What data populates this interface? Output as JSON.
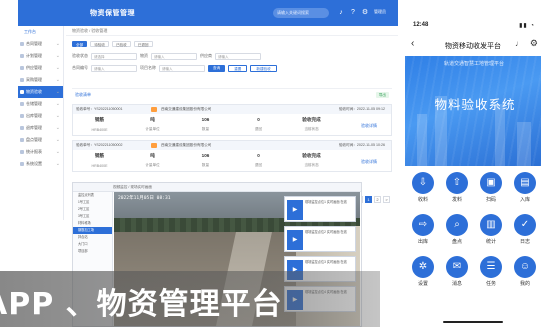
{
  "desktop": {
    "title": "物资保管管理",
    "search_placeholder": "请输入关键词搜索",
    "user": "管理员",
    "brand": "工作台",
    "nav": [
      "合同管理",
      "计划管理",
      "供应管理",
      "采购管理",
      "物资验收",
      "仓储管理",
      "出库管理",
      "退库管理",
      "盘点管理",
      "统计报表",
      "系统设置"
    ],
    "active_nav": 4,
    "breadcrumb": "物资验收 / 验收管理",
    "tabs": [
      "全部",
      "待验收",
      "已验收",
      "已退回"
    ],
    "filter_labels": {
      "row2_a": "验收状态",
      "row2_b": "物资",
      "row2_c": "供应商",
      "row3_a": "合同编号",
      "row3_b": "项目名称"
    },
    "placeholders": {
      "a": "请选择",
      "b": "请输入",
      "c": "请输入"
    },
    "buttons": {
      "search": "查询",
      "reset": "重置",
      "add": "新建验收"
    },
    "list_title": "验收清单",
    "export": "导出",
    "cards": [
      {
        "no": "验收单号：YS202211050001",
        "org": "西南交通建设集团股份有限公司",
        "time": "验收时间：2022-11-05 09:12",
        "cols": [
          "钢筋",
          "吨",
          "106",
          "0",
          "验收完成"
        ],
        "subs": [
          "HRB400E",
          "计量单位",
          "数量",
          "退回",
          "当前状态"
        ],
        "link": "验收详情"
      },
      {
        "no": "验收单号：YS202211050002",
        "org": "西南交通建设集团股份有限公司",
        "time": "验收时间：2022-11-05 10:26",
        "cols": [
          "钢筋",
          "吨",
          "106",
          "0",
          "验收完成"
        ],
        "subs": [
          "HRB400E",
          "计量单位",
          "数量",
          "退回",
          "当前状态"
        ],
        "link": "验收详情"
      }
    ],
    "pager": [
      "<",
      "1",
      "2",
      ">"
    ]
  },
  "mobile": {
    "time": "12:48",
    "battery": "▮▮ ◔",
    "back": "‹",
    "title": "物资移动收发平台",
    "banner_sub": "轨道交通智慧工地管理平台",
    "banner_big": "物料验收系统",
    "tiles": [
      "收料",
      "发料",
      "扫码",
      "入库",
      "出库",
      "盘点",
      "统计",
      "日志",
      "设置",
      "消息",
      "任务",
      "我的"
    ]
  },
  "camera": {
    "top": "视频监控 / 现场实时画面",
    "tree": [
      "监控点列表",
      "1号工区",
      "2号工区",
      "3号工区",
      "材料堆场",
      "钢筋加工场",
      "拌合站",
      "大门口",
      "项目部"
    ],
    "tree_selected": 5,
    "timestamp": "2022年11月05日 08:31",
    "thumbs": [
      "现场监控点位1  实时画面  在线",
      "现场监控点位2  实时画面  在线",
      "现场监控点位3  实时画面  在线",
      "现场监控点位4  实时画面  在线"
    ]
  },
  "caption": "APP 、物资管理平台"
}
